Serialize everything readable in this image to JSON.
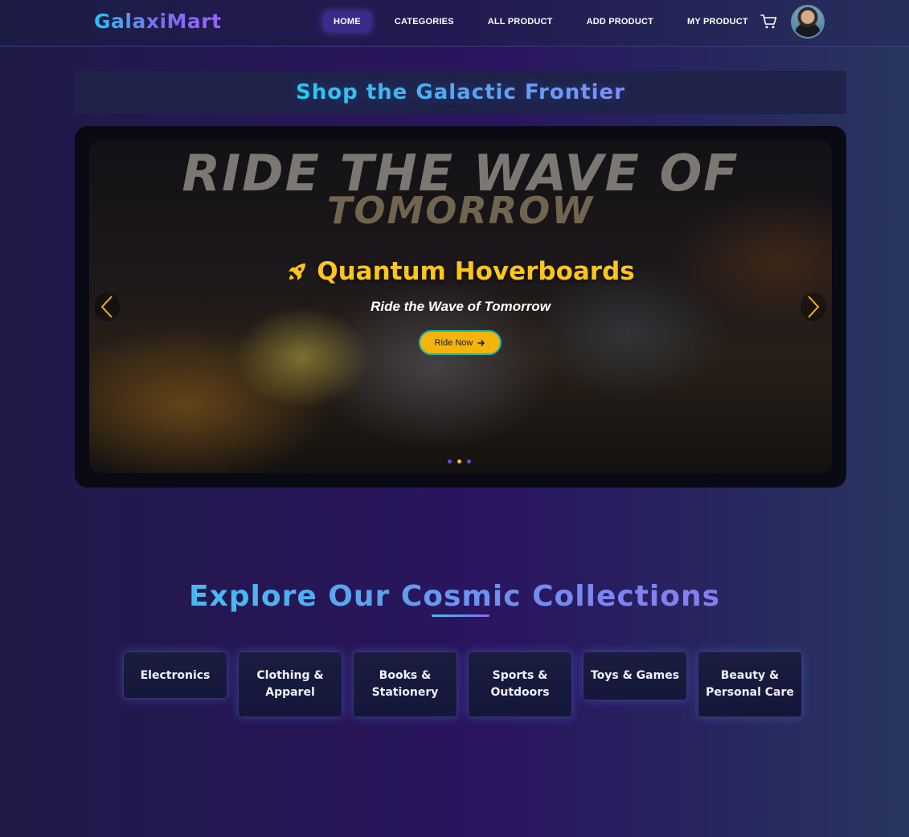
{
  "brand": {
    "logo_text": "GalaxiMart"
  },
  "nav": {
    "links": [
      {
        "label": "HOME",
        "active": true
      },
      {
        "label": "CATEGORIES",
        "active": false
      },
      {
        "label": "ALL PRODUCT",
        "active": false
      },
      {
        "label": "ADD PRODUCT",
        "active": false
      },
      {
        "label": "MY PRODUCT",
        "active": false
      }
    ],
    "cart_icon": "shopping-cart-icon",
    "avatar_icon": "user-avatar"
  },
  "hero": {
    "title": "Shop the Galactic Frontier"
  },
  "slider": {
    "image_text_line1": "RIDE THE WAVE OF",
    "image_text_line2": "TOMORROW",
    "heading": "Quantum Hoverboards",
    "heading_icon": "rocket-icon",
    "subtitle": "Ride the Wave of Tomorrow",
    "cta_label": "Ride Now",
    "cta_icon": "arrow-right-icon",
    "slide_count": 3,
    "active_slide": 2
  },
  "collections": {
    "title": "Explore Our Cosmic Collections",
    "categories": [
      "Electronics",
      "Clothing & Apparel",
      "Books & Stationery",
      "Sports & Outdoors",
      "Toys & Games",
      "Beauty & Personal Care"
    ]
  },
  "colors": {
    "accent_yellow": "#ffc51a",
    "nav_active": "#3a2a8a",
    "cyan": "#22c7f5",
    "violet": "#8a7cf0"
  }
}
